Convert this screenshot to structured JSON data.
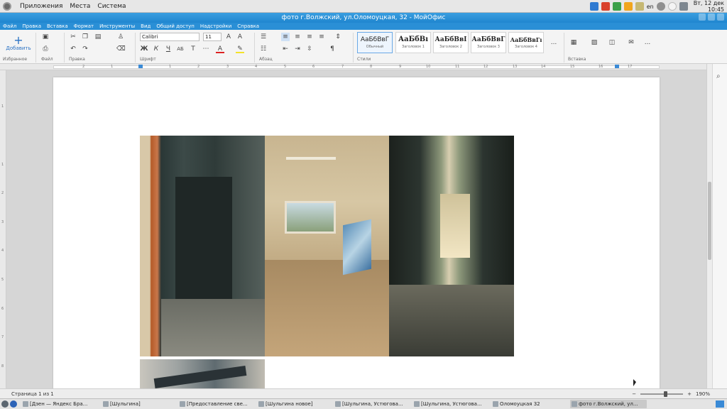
{
  "system_panel": {
    "menu": [
      "Приложения",
      "Места",
      "Система"
    ],
    "keyboard_layout": "en",
    "clock_line1": "Вт, 12 дек",
    "clock_line2": "10:45"
  },
  "window": {
    "title": "фото г.Волжский, ул.Оломоуцкая, 32 - МойОфис"
  },
  "menubar": [
    "Файл",
    "Правка",
    "Вставка",
    "Формат",
    "Инструменты",
    "Вид",
    "Общий доступ",
    "Надстройки",
    "Справка"
  ],
  "toolbar": {
    "add_label": "Добавить",
    "favorites_label": "Избранное",
    "file_label": "Файл",
    "edit_label": "Правка",
    "font_label": "Шрифт",
    "paragraph_label": "Абзац",
    "styles_label": "Стили",
    "insert_label": "Вставка",
    "font_name": "Calibri",
    "font_size": "11",
    "styles": [
      {
        "sample": "АаБбВвГ",
        "name": "Обычный"
      },
      {
        "sample": "АаБбВı",
        "name": "Заголовок 1"
      },
      {
        "sample": "АаБбВвI",
        "name": "Заголовок 2"
      },
      {
        "sample": "АаБбВвГ",
        "name": "Заголовок 3"
      },
      {
        "sample": "АаБбВвГı",
        "name": "Заголовок 4"
      }
    ],
    "more_label": "..."
  },
  "ruler": {
    "numbers": [
      "2",
      "1",
      "1",
      "2",
      "3",
      "4",
      "5",
      "6",
      "7",
      "8",
      "9",
      "10",
      "11",
      "12",
      "13",
      "14",
      "15",
      "16",
      "17"
    ]
  },
  "vruler": {
    "numbers": [
      "1",
      "1",
      "2",
      "3",
      "4",
      "5",
      "6",
      "7",
      "8"
    ]
  },
  "status": {
    "pages": "Страница 1 из 1",
    "zoom": "190%",
    "zoom_level": 0.6
  },
  "taskbar": {
    "tasks": [
      "[Дзен — Яндекс Бра...",
      "[Шульгина]",
      "[Предоставление све...",
      "[Шульгина новое]",
      "[Шульгина, Устюгова...",
      "[Шульгина, Устюгова...",
      "Оломоуцкая 32",
      "фото г.Волжский, ул..."
    ]
  }
}
